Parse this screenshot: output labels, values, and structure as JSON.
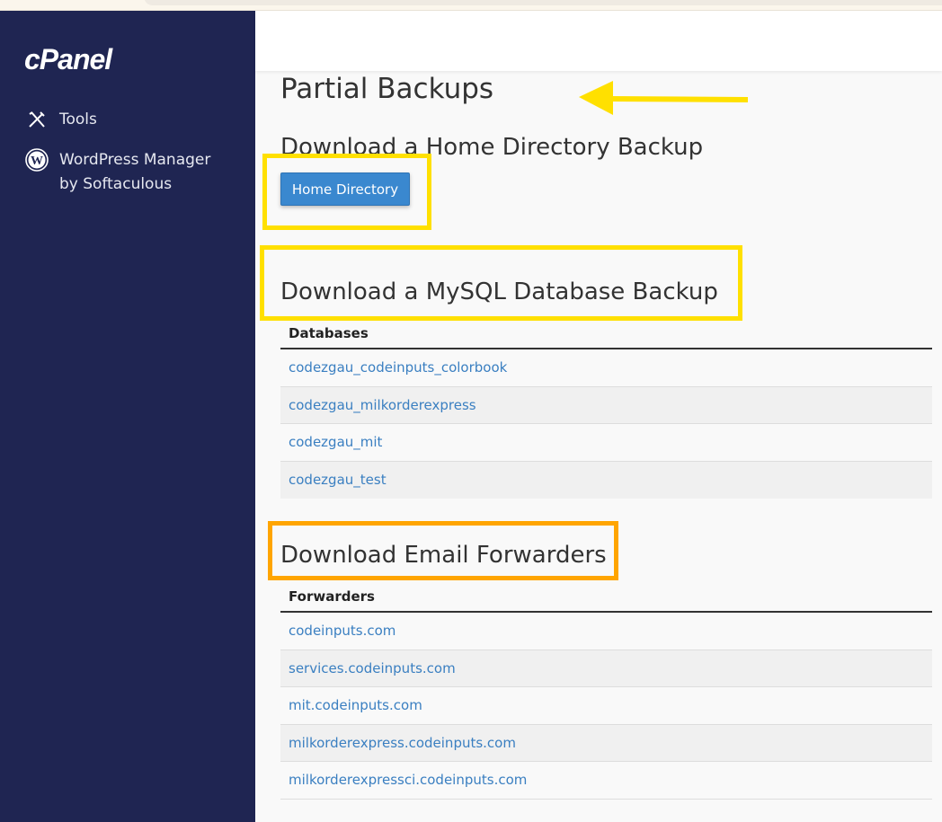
{
  "sidebar": {
    "logo": "cPanel",
    "items": [
      {
        "label": "Tools",
        "icon": "tools-icon"
      },
      {
        "label": "WordPress Manager by Softaculous",
        "line1": "WordPress Manager",
        "line2": "by Softaculous",
        "icon": "wordpress-icon"
      }
    ]
  },
  "main": {
    "title": "Partial Backups",
    "home": {
      "heading": "Download a Home Directory Backup",
      "button": "Home Directory"
    },
    "mysql": {
      "heading": "Download a MySQL Database Backup",
      "column": "Databases",
      "rows": [
        "codezgau_codeinputs_colorbook",
        "codezgau_milkorderexpress",
        "codezgau_mit",
        "codezgau_test"
      ]
    },
    "email": {
      "heading": "Download Email Forwarders",
      "column": "Forwarders",
      "rows": [
        "codeinputs.com",
        "services.codeinputs.com",
        "mit.codeinputs.com",
        "milkorderexpress.codeinputs.com",
        "milkorderexpressci.codeinputs.com"
      ]
    }
  },
  "colors": {
    "sidebar": "#1f2552",
    "button": "#3a88cf",
    "link": "#3a7fc1",
    "highlight_yellow": "#ffe000",
    "highlight_orange": "#ffa500"
  }
}
